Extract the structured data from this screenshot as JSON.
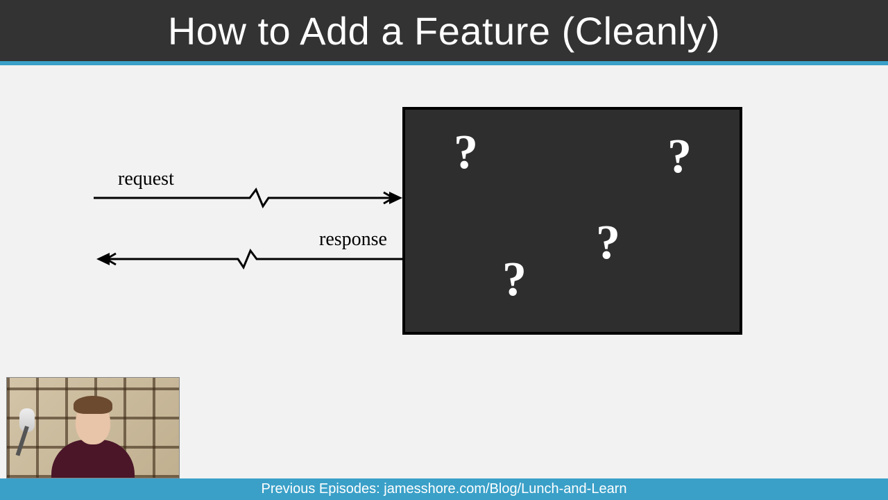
{
  "header": {
    "title": "How to Add a Feature (Cleanly)"
  },
  "diagram": {
    "request_label": "request",
    "response_label": "response",
    "qmarks": [
      "?",
      "?",
      "?",
      "?"
    ]
  },
  "footer": {
    "text": "Previous Episodes: jamesshore.com/Blog/Lunch-and-Learn"
  }
}
